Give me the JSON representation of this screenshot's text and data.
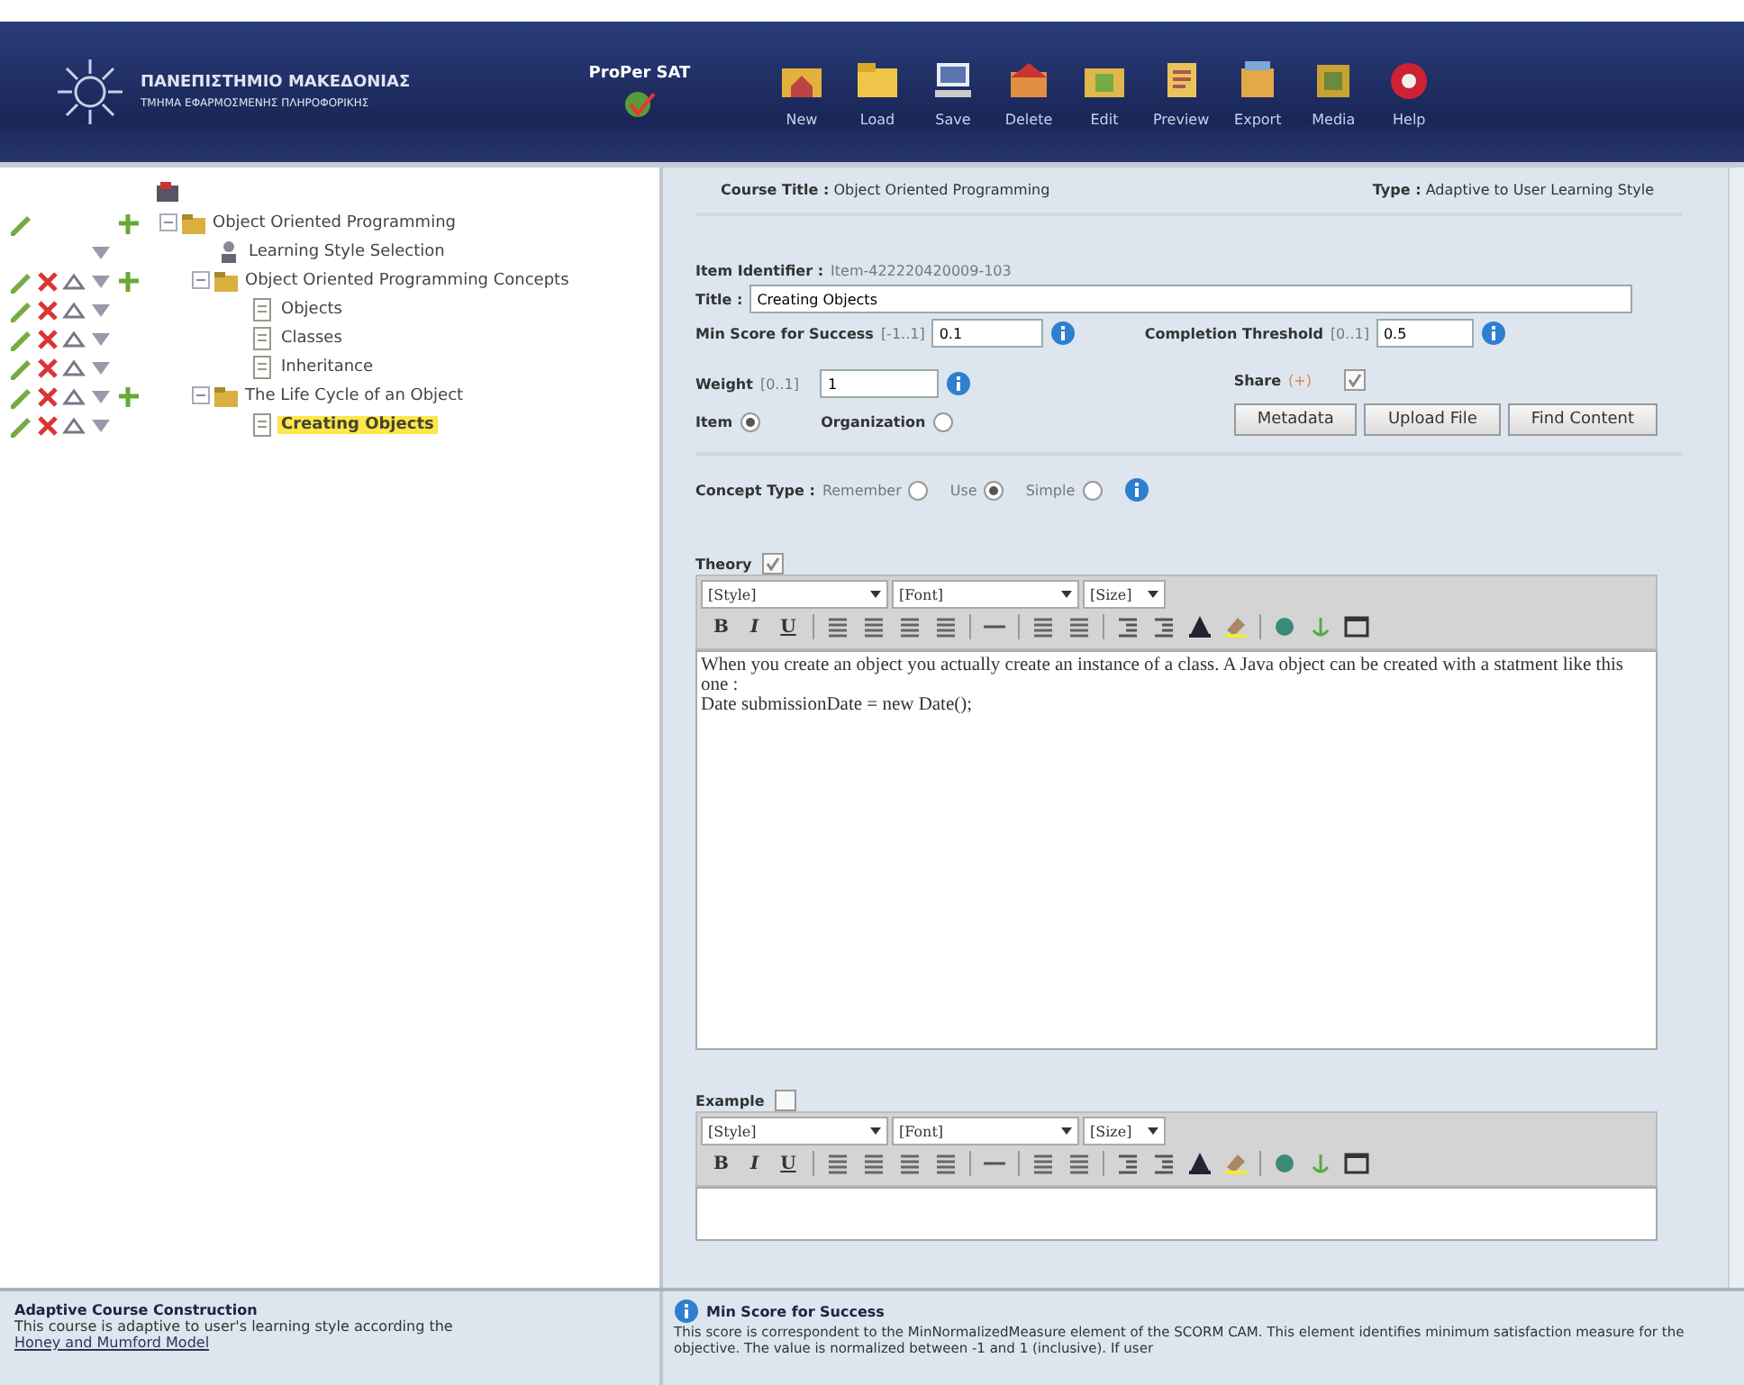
{
  "header": {
    "logo_title": "ΠΑΝΕΠΙΣΤΗΜΙΟ ΜΑΚΕΔΟΝΙΑΣ",
    "logo_subtitle": "ΤΜΗΜΑ ΕΦΑΡΜΟΣΜΕΝΗΣ ΠΛΗΡΟΦΟΡΙΚΗΣ",
    "app_name": "ProPer SAT",
    "toolbar": [
      {
        "label": "New",
        "kind": "new"
      },
      {
        "label": "Load",
        "kind": "load"
      },
      {
        "label": "Save",
        "kind": "save"
      },
      {
        "label": "Delete",
        "kind": "delete"
      },
      {
        "label": "Edit",
        "kind": "edit"
      },
      {
        "label": "Preview",
        "kind": "preview"
      },
      {
        "label": "Export",
        "kind": "export"
      },
      {
        "label": "Media",
        "kind": "media"
      },
      {
        "label": "Help",
        "kind": "help"
      }
    ]
  },
  "tree": [
    {
      "label": "Object Oriented Programming",
      "kind": "folder",
      "can_edit": true,
      "can_delete": false,
      "can_move_up": false,
      "can_move_down": false,
      "can_add": true,
      "expanded": true,
      "selected": false,
      "children": [
        {
          "label": "Learning Style Selection",
          "kind": "style",
          "can_edit": false,
          "can_delete": false,
          "can_move_up": false,
          "can_move_down": true,
          "can_add": false,
          "selected": false
        },
        {
          "label": "Object Oriented Programming Concepts",
          "kind": "folder",
          "can_edit": true,
          "can_delete": true,
          "can_move_up": true,
          "can_move_down": true,
          "can_add": true,
          "expanded": true,
          "selected": false,
          "children": [
            {
              "label": "Objects",
              "kind": "page",
              "can_edit": true,
              "can_delete": true,
              "can_move_up": true,
              "can_move_down": true,
              "can_add": false,
              "selected": false
            },
            {
              "label": "Classes",
              "kind": "page",
              "can_edit": true,
              "can_delete": true,
              "can_move_up": true,
              "can_move_down": true,
              "can_add": false,
              "selected": false
            },
            {
              "label": "Inheritance",
              "kind": "page",
              "can_edit": true,
              "can_delete": true,
              "can_move_up": true,
              "can_move_down": true,
              "can_add": false,
              "selected": false
            }
          ]
        },
        {
          "label": "The Life Cycle of an Object",
          "kind": "folder",
          "can_edit": true,
          "can_delete": true,
          "can_move_up": true,
          "can_move_down": true,
          "can_add": true,
          "expanded": true,
          "selected": false,
          "children": [
            {
              "label": "Creating Objects",
              "kind": "page",
              "can_edit": true,
              "can_delete": true,
              "can_move_up": true,
              "can_move_down": true,
              "can_add": false,
              "selected": true
            }
          ]
        }
      ]
    }
  ],
  "course": {
    "title_label": "Course Title :",
    "title": "Object Oriented Programming",
    "type_label": "Type :",
    "type": "Adaptive to User Learning Style"
  },
  "item": {
    "identifier_label": "Item Identifier :",
    "identifier": "Item-422220420009-103",
    "title_label": "Title :",
    "title": "Creating Objects",
    "min_score_label": "Min Score for Success",
    "min_score_range": "[-1..1]",
    "min_score": "0.1",
    "threshold_label": "Completion Threshold",
    "threshold_range": "[0..1]",
    "threshold": "0.5",
    "weight_label": "Weight",
    "weight_range": "[0..1]",
    "weight": "1",
    "share_label": "Share",
    "share_hint": "(+)",
    "share_checked": true,
    "kinds": [
      {
        "label": "Item",
        "selected": true
      },
      {
        "label": "Organization",
        "selected": false
      }
    ],
    "buttons": [
      "Metadata",
      "Upload File",
      "Find Content"
    ],
    "concept_label": "Concept Type :",
    "concept_types": [
      {
        "label": "Remember",
        "selected": false
      },
      {
        "label": "Use",
        "selected": true
      },
      {
        "label": "Simple",
        "selected": false
      }
    ]
  },
  "editors": [
    {
      "label": "Theory",
      "checked": true,
      "selects": [
        "[Style]",
        "[Font]",
        "[Size]"
      ],
      "format_buttons": [
        "B",
        "I",
        "U"
      ],
      "text": "When you create an object you actually create an instance of a class. A Java object can be created with a statment like this one :\nDate submissionDate = new Date();"
    },
    {
      "label": "Example",
      "checked": false,
      "selects": [
        "[Style]",
        "[Font]",
        "[Size]"
      ],
      "format_buttons": [
        "B",
        "I",
        "U"
      ]
    }
  ],
  "footer_left": {
    "title": "Adaptive Course Construction",
    "text": "This course is adaptive to user's learning style according the",
    "link": "Honey and Mumford Model"
  },
  "footer_right": {
    "title": "Min Score for Success",
    "text": "This score is correspondent to the MinNormalizedMeasure element of the SCORM CAM. This element identifies minimum satisfaction measure for the objective. The value is normalized between -1 and 1 (inclusive). If user"
  }
}
